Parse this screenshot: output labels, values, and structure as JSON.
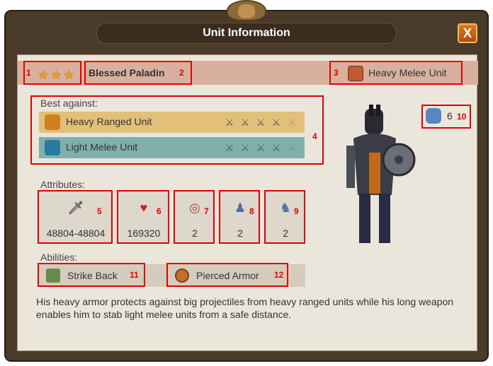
{
  "window": {
    "title": "Unit Information",
    "close_label": "X"
  },
  "unit": {
    "stars": 3,
    "name": "Blessed Paladin",
    "type": "Heavy Melee Unit",
    "type_icon": "fist-icon",
    "count": "6",
    "count_icon": "units-icon"
  },
  "best_against": {
    "label": "Best against:",
    "rows": [
      {
        "name": "Heavy Ranged Unit",
        "icon": "fist-shield-icon",
        "color": "#e2c07a",
        "bonus": "4 of 5"
      },
      {
        "name": "Light Melee Unit",
        "icon": "sword-icon",
        "color": "#7fb0ac",
        "bonus": "4 of 5"
      }
    ]
  },
  "attributes": {
    "label": "Attributes:",
    "items": [
      {
        "icon": "sword-icon",
        "value": "48804-48804"
      },
      {
        "icon": "heart-icon",
        "value": "169320"
      },
      {
        "icon": "target-icon",
        "value": "2"
      },
      {
        "icon": "movement-icon",
        "value": "2"
      },
      {
        "icon": "initiative-icon",
        "value": "2"
      }
    ]
  },
  "abilities": {
    "label": "Abilities:",
    "items": [
      {
        "icon": "strike-back-icon",
        "name": "Strike Back"
      },
      {
        "icon": "pierced-armor-icon",
        "name": "Pierced Armor"
      }
    ]
  },
  "description": "His heavy armor protects against big projectiles from heavy ranged units while his long weapon enables him to stab light melee units from a safe distance.",
  "annotations": [
    "1",
    "2",
    "3",
    "4",
    "5",
    "6",
    "7",
    "8",
    "9",
    "10",
    "11",
    "12"
  ]
}
